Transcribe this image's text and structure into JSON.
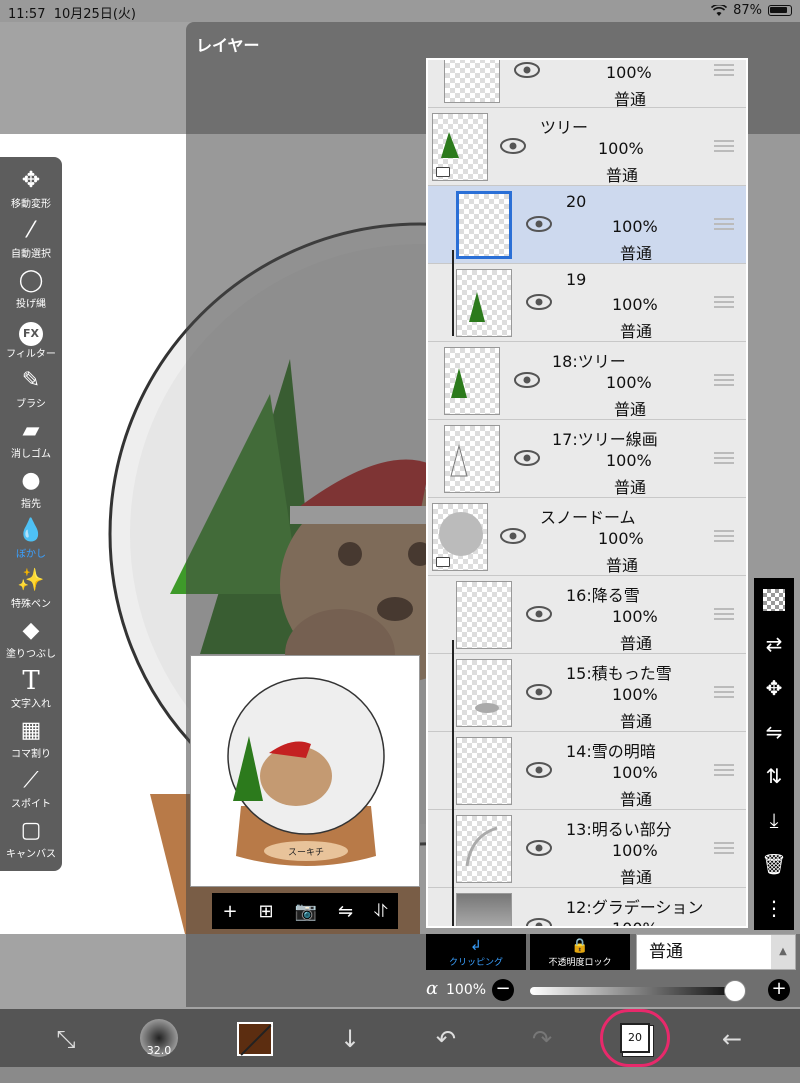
{
  "status_bar": {
    "time": "11:57",
    "date": "10月25日(火)",
    "battery": "87%"
  },
  "toolbar": {
    "items": [
      {
        "label": "移動変形",
        "icon": "move-icon"
      },
      {
        "label": "自動選択",
        "icon": "magic-wand-icon"
      },
      {
        "label": "投げ縄",
        "icon": "lasso-icon"
      },
      {
        "label": "フィルター",
        "icon": "fx-icon"
      },
      {
        "label": "ブラシ",
        "icon": "brush-icon"
      },
      {
        "label": "消しゴム",
        "icon": "eraser-icon"
      },
      {
        "label": "指先",
        "icon": "smudge-icon"
      },
      {
        "label": "ぼかし",
        "icon": "blur-icon"
      },
      {
        "label": "特殊ペン",
        "icon": "special-pen-icon"
      },
      {
        "label": "塗りつぶし",
        "icon": "fill-icon"
      },
      {
        "label": "文字入れ",
        "icon": "text-icon"
      },
      {
        "label": "コマ割り",
        "icon": "frame-divider-icon"
      },
      {
        "label": "スポイト",
        "icon": "eyedropper-icon"
      },
      {
        "label": "キャンバス",
        "icon": "canvas-icon"
      }
    ],
    "fx_glyph": "FX",
    "text_glyph": "T",
    "active_index": 7,
    "active_color": "#3aa0ff"
  },
  "layer_panel": {
    "title": "レイヤー",
    "layers": [
      {
        "name": "",
        "opacity": "100%",
        "blend": "普通"
      },
      {
        "name": "ツリー",
        "opacity": "100%",
        "blend": "普通"
      },
      {
        "name": "20",
        "opacity": "100%",
        "blend": "普通"
      },
      {
        "name": "19",
        "opacity": "100%",
        "blend": "普通"
      },
      {
        "name": "18:ツリー",
        "opacity": "100%",
        "blend": "普通"
      },
      {
        "name": "17:ツリー線画",
        "opacity": "100%",
        "blend": "普通"
      },
      {
        "name": "スノードーム",
        "opacity": "100%",
        "blend": "普通"
      },
      {
        "name": "16:降る雪",
        "opacity": "100%",
        "blend": "普通"
      },
      {
        "name": "15:積もった雪",
        "opacity": "100%",
        "blend": "普通"
      },
      {
        "name": "14:雪の明暗",
        "opacity": "100%",
        "blend": "普通"
      },
      {
        "name": "13:明るい部分",
        "opacity": "100%",
        "blend": "普通"
      },
      {
        "name": "12:グラデーション",
        "opacity": "100%",
        "blend": ""
      }
    ],
    "selected_index": 2,
    "clipping_label": "クリッピング",
    "alpha_lock_label": "不透明度ロック",
    "blend_mode": "普通",
    "alpha_symbol": "α",
    "alpha_value": "100%",
    "alpha_fraction": 1.0
  },
  "preview": {
    "nameplate": "スーキチ"
  },
  "bottom_bar": {
    "brush_size": "32.0",
    "layer_count": "20"
  },
  "colors": {
    "accent": "#3aa0ff",
    "selected_row": "#cdd9ee",
    "highlight_circle": "#e8296b",
    "current_color": "#5c2d10"
  }
}
